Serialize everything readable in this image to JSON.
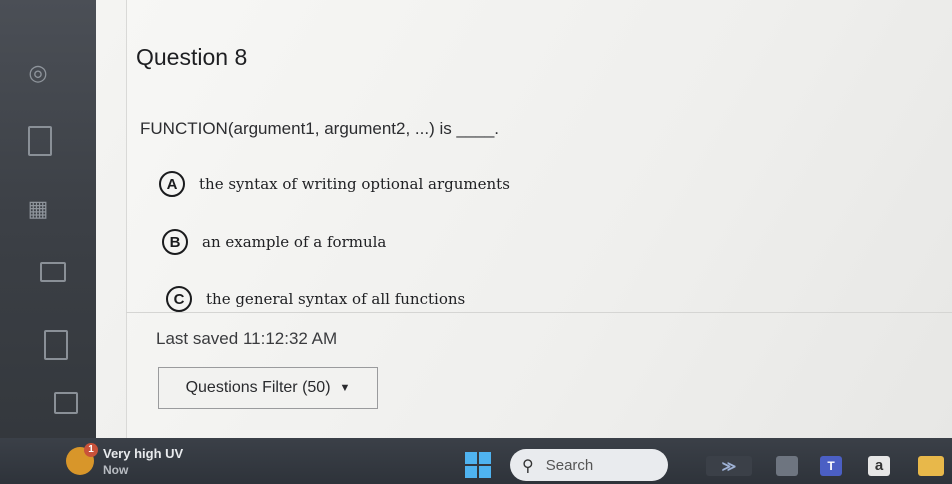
{
  "question": {
    "title": "Question 8",
    "prompt": "FUNCTION(argument1, argument2, ...) is ____.",
    "options": [
      {
        "letter": "A",
        "text": "the syntax of writing optional arguments"
      },
      {
        "letter": "B",
        "text": "an example of a formula"
      },
      {
        "letter": "C",
        "text": "the general syntax of all functions"
      }
    ]
  },
  "status": {
    "last_saved": "Last saved 11:12:32 AM"
  },
  "filter": {
    "label": "Questions Filter (50)",
    "caret": "▼"
  },
  "taskbar": {
    "weather_badge": "1",
    "weather_title": "Very high UV",
    "weather_sub": "Now",
    "search_label": "Search",
    "search_glyph": "⚲",
    "teams_label": "T",
    "app_a_label": "a"
  },
  "colors": {
    "panel": "#f4f4f2",
    "text": "#1e1f22",
    "windows_blue": "#4fb3f0",
    "taskbar": "#2e333a"
  }
}
